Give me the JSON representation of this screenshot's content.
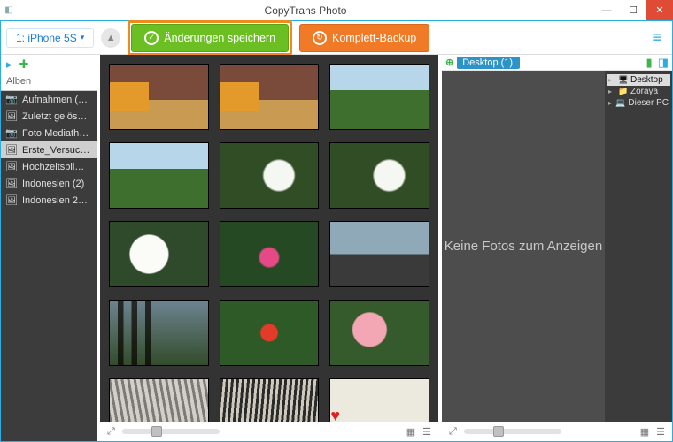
{
  "window": {
    "title": "CopyTrans Photo"
  },
  "toolbar": {
    "device_name": "1: iPhone 5S",
    "save_label": "Änderungen speichern",
    "backup_label": "Komplett-Backup"
  },
  "sidebar": {
    "header": "Alben",
    "items": [
      {
        "glyph": "📷",
        "label": "Aufnahmen (…"
      },
      {
        "glyph": "🖼",
        "label": "Zuletzt gelös…"
      },
      {
        "glyph": "📷",
        "label": "Foto Mediath…"
      },
      {
        "glyph": "🖼",
        "label": "Erste_Versuc…",
        "selected": true
      },
      {
        "glyph": "🖼",
        "label": "Hochzeitsbil…"
      },
      {
        "glyph": "🖼",
        "label": "Indonesien (2)"
      },
      {
        "glyph": "🖼",
        "label": "Indonesien 2…"
      }
    ]
  },
  "breadcrumb": {
    "label": "Desktop (1)"
  },
  "drop": {
    "empty_text": "Keine Fotos zum Anzeigen"
  },
  "tree": {
    "items": [
      {
        "label": "Desktop",
        "selected": true,
        "glyph": "🖥"
      },
      {
        "label": "Zoraya",
        "glyph": "📁"
      },
      {
        "label": "Dieser PC",
        "glyph": "💻"
      }
    ]
  },
  "thumbs": [
    "p1",
    "p1",
    "p5",
    "p5",
    "p6",
    "p6",
    "p7",
    "p8",
    "p9",
    "p10",
    "p11",
    "p12",
    "p13",
    "p14",
    "p15"
  ]
}
